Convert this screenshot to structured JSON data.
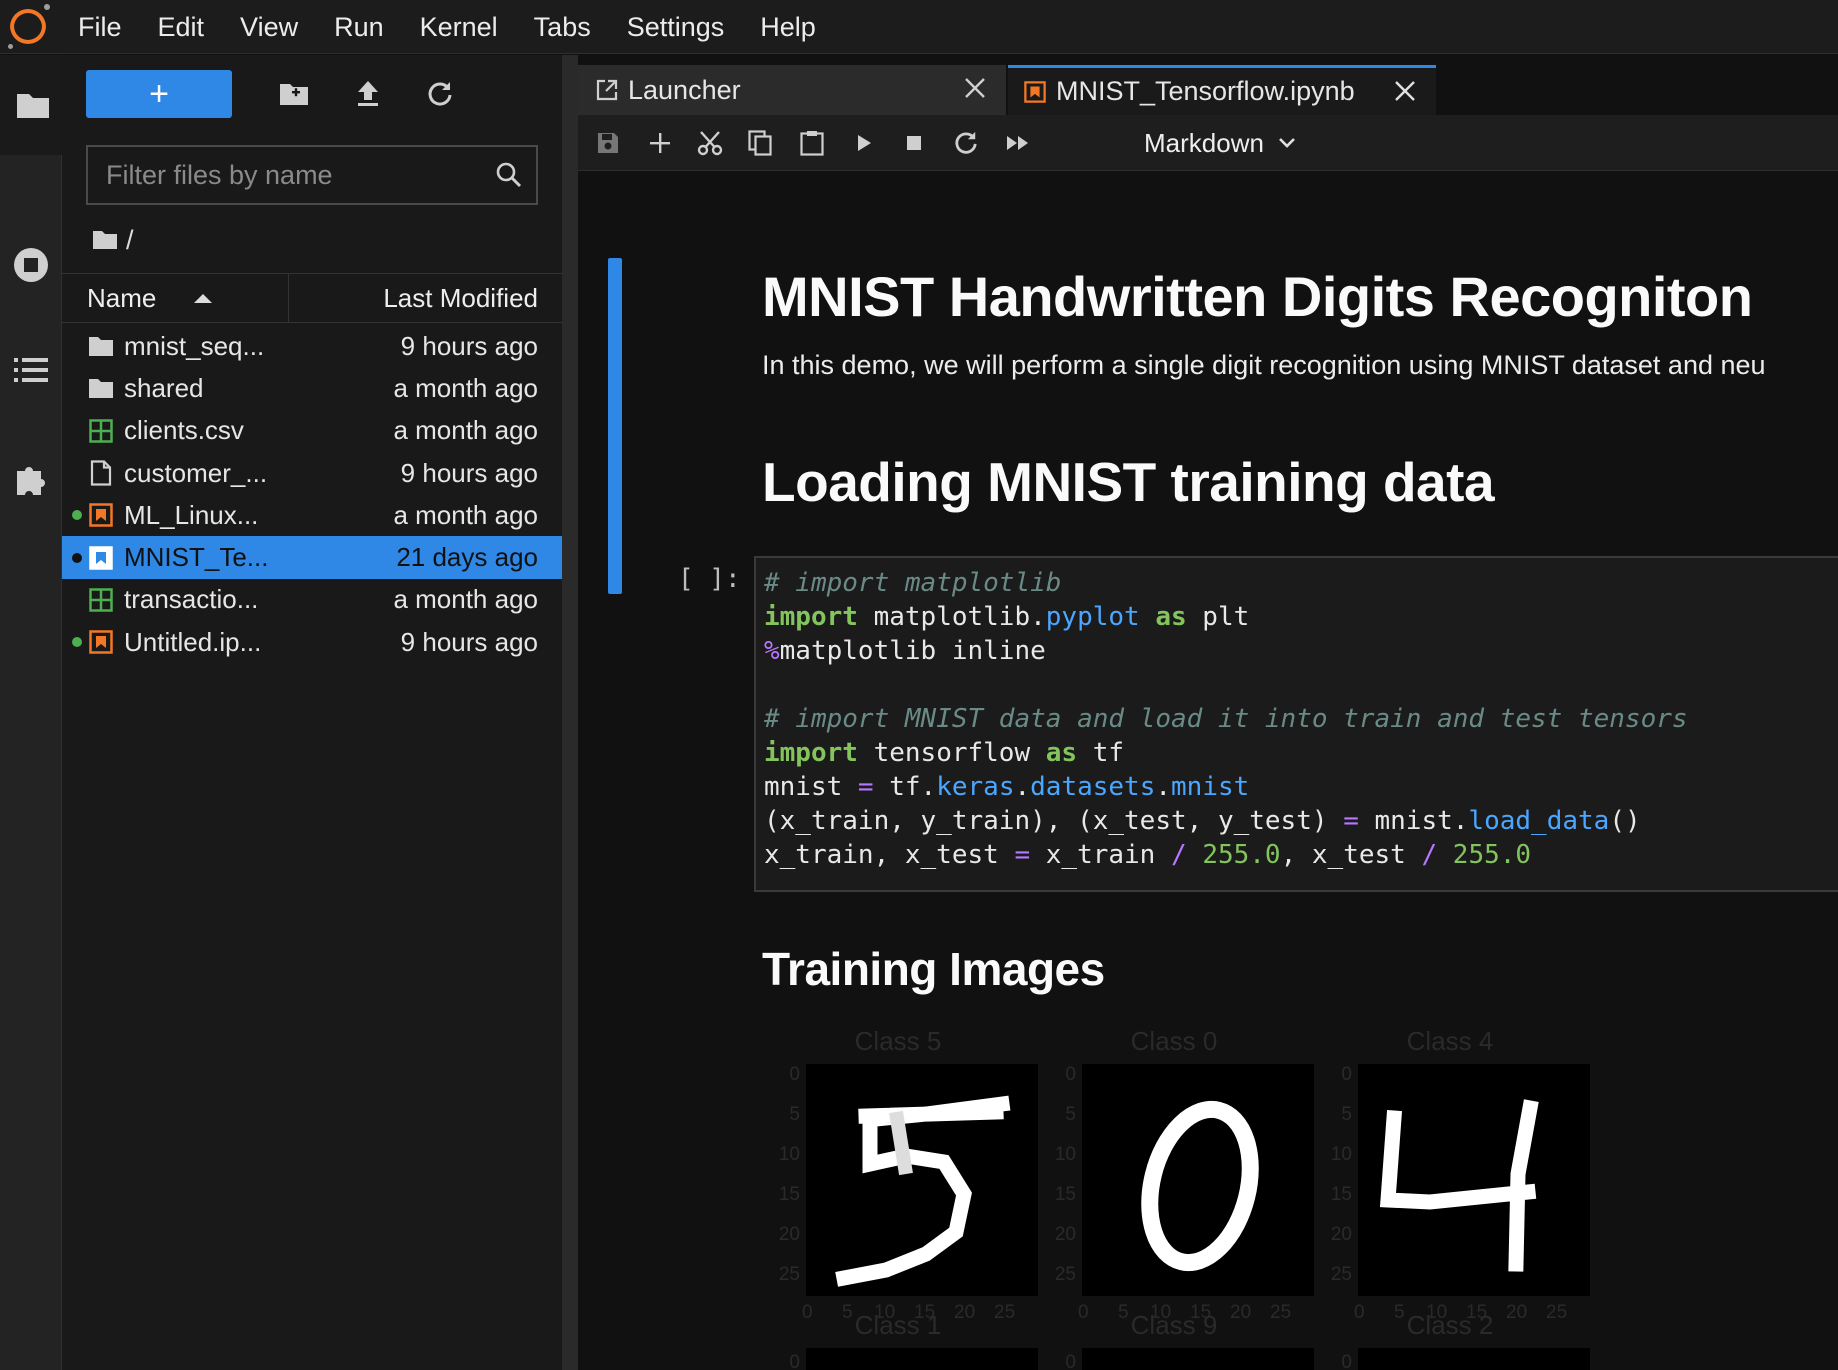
{
  "menubar": {
    "items": [
      "File",
      "Edit",
      "View",
      "Run",
      "Kernel",
      "Tabs",
      "Settings",
      "Help"
    ]
  },
  "activitybar": {
    "icons": [
      "folder-icon",
      "running-icon",
      "toc-icon",
      "extension-icon"
    ]
  },
  "filebrowser": {
    "new_label": "+",
    "filter_placeholder": "Filter files by name",
    "breadcrumb": "/",
    "columns": {
      "name": "Name",
      "modified": "Last Modified"
    },
    "files": [
      {
        "name": "mnist_seq...",
        "modified": "9 hours ago",
        "type": "folder",
        "running": false
      },
      {
        "name": "shared",
        "modified": "a month ago",
        "type": "folder",
        "running": false
      },
      {
        "name": "clients.csv",
        "modified": "a month ago",
        "type": "csv",
        "running": false
      },
      {
        "name": "customer_...",
        "modified": "9 hours ago",
        "type": "file",
        "running": false
      },
      {
        "name": "ML_Linux...",
        "modified": "a month ago",
        "type": "notebook",
        "running": true
      },
      {
        "name": "MNIST_Te...",
        "modified": "21 days ago",
        "type": "notebook",
        "running": true,
        "selected": true
      },
      {
        "name": "transactio...",
        "modified": "a month ago",
        "type": "csv",
        "running": false
      },
      {
        "name": "Untitled.ip...",
        "modified": "9 hours ago",
        "type": "notebook",
        "running": true
      }
    ]
  },
  "tabs": [
    {
      "label": "Launcher",
      "icon": "launcher-icon",
      "active": false
    },
    {
      "label": "MNIST_Tensorflow.ipynb",
      "icon": "notebook-icon",
      "active": true
    }
  ],
  "notebook_toolbar": {
    "cell_type": "Markdown"
  },
  "notebook": {
    "title": "MNIST Handwritten Digits Recogniton",
    "intro": "In this demo, we will perform a single digit recognition using MNIST dataset and neu",
    "section1": "Loading MNIST training data",
    "prompt": "[ ]:",
    "code_lines": [
      "# import matplotlib",
      "import matplotlib.pyplot as plt",
      "%matplotlib inline",
      "",
      "# import MNIST data and load it into train and test tensors",
      "import tensorflow as tf",
      "mnist = tf.keras.datasets.mnist",
      "(x_train, y_train), (x_test, y_test) = mnist.load_data()",
      "x_train, x_test = x_train / 255.0, x_test / 255.0"
    ],
    "section2": "Training Images",
    "figure": {
      "panels": [
        {
          "title": "Class 5",
          "digit": "5",
          "next_title": "Class 1"
        },
        {
          "title": "Class 0",
          "digit": "0",
          "next_title": "Class 9"
        },
        {
          "title": "Class 4",
          "digit": "4",
          "next_title": "Class 2"
        }
      ],
      "y_ticks": [
        "0",
        "5",
        "10",
        "15",
        "20",
        "25"
      ],
      "x_ticks": [
        "0",
        "5",
        "10",
        "15",
        "20",
        "25"
      ],
      "next_row_tick": "0"
    }
  },
  "colors": {
    "accent": "#2f88e6",
    "jupyter_orange": "#f37726",
    "running_green": "#4caf50",
    "csv_green": "#4caf50"
  }
}
